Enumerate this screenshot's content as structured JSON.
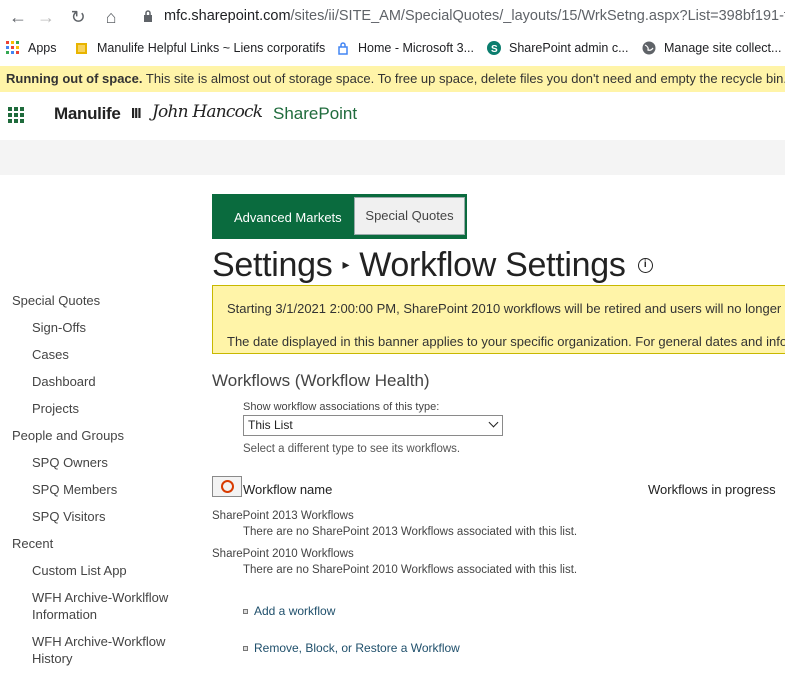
{
  "browser": {
    "url_host": "mfc.sharepoint.com",
    "url_path": "/sites/ii/SITE_AM/SpecialQuotes/_layouts/15/WrkSetng.aspx?List=398bf191-f74e",
    "bookmarks": [
      {
        "label": "Apps",
        "icon": "apps-grid-icon"
      },
      {
        "label": "Manulife Helpful Links ~ Liens corporatifs",
        "icon": "folder-icon"
      },
      {
        "label": "Home - Microsoft 3...",
        "icon": "office-lock-icon"
      },
      {
        "label": "SharePoint admin c...",
        "icon": "sharepoint-icon"
      },
      {
        "label": "Manage site collect...",
        "icon": "globe-icon"
      }
    ]
  },
  "storage_banner": {
    "bold": "Running out of space.",
    "text": " This site is almost out of storage space. To free up space, delete files you don't need and empty the recycle bin."
  },
  "suite": {
    "brand1": "Manulife",
    "brand_mark": "III",
    "brand2": "John Hancock",
    "app": "SharePoint",
    "accent": "#1f6b3c"
  },
  "tabs": {
    "advanced": "Advanced Markets",
    "special": "Special Quotes"
  },
  "title": {
    "part1": "Settings",
    "part2": "Workflow Settings"
  },
  "retire_banner": {
    "line1": "Starting 3/1/2021 2:00:00 PM, SharePoint 2010 workflows will be retired and users will no longer h",
    "line2": "The date displayed in this banner applies to your specific organization. For general dates and info"
  },
  "leftnav": [
    {
      "label": "Special Quotes",
      "level": "hdr"
    },
    {
      "label": "Sign-Offs",
      "level": "sub"
    },
    {
      "label": "Cases",
      "level": "sub"
    },
    {
      "label": "Dashboard",
      "level": "sub"
    },
    {
      "label": "Projects",
      "level": "sub"
    },
    {
      "label": "People and Groups",
      "level": "hdr"
    },
    {
      "label": "SPQ Owners",
      "level": "sub"
    },
    {
      "label": "SPQ Members",
      "level": "sub"
    },
    {
      "label": "SPQ Visitors",
      "level": "sub"
    },
    {
      "label": "Recent",
      "level": "hdr"
    },
    {
      "label": "Custom List App",
      "level": "sub"
    },
    {
      "label": "WFH Archive-Worklflow",
      "level": "sub"
    },
    {
      "label": "Information",
      "level": "sub"
    },
    {
      "label": "WFH Archive-Workflow",
      "level": "sub"
    },
    {
      "label": "History",
      "level": "sub"
    }
  ],
  "workflows": {
    "heading": "Workflows  (Workflow Health)",
    "show_label": "Show workflow associations of this type:",
    "select_value": "This List",
    "select_hint": "Select a different type to see its workflows.",
    "col_name": "Workflow name",
    "col_progress": "Workflows in progress",
    "group_2013": "SharePoint 2013 Workflows",
    "empty_2013": "There are no SharePoint 2013 Workflows associated with this list.",
    "group_2010": "SharePoint 2010 Workflows",
    "empty_2010": "There are no SharePoint 2010 Workflows associated with this list.",
    "add": "Add a workflow",
    "remove": "Remove, Block, or Restore a Workflow"
  }
}
